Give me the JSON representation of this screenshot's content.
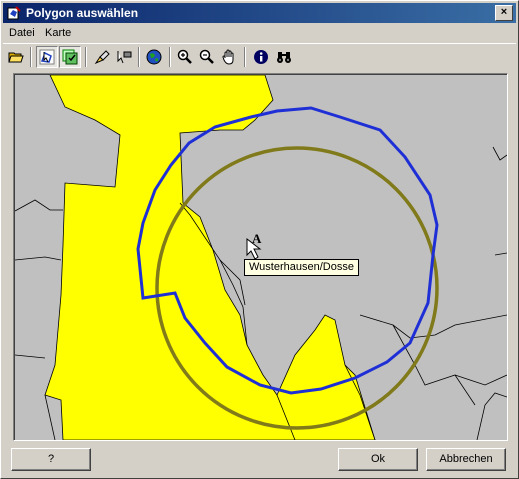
{
  "window": {
    "title": "Polygon auswählen",
    "close_glyph": "×"
  },
  "menu": [
    "Datei",
    "Karte"
  ],
  "toolbar": {
    "buttons": [
      {
        "icon": "open-folder-icon"
      },
      {
        "icon": "select-polygon-icon",
        "pressed": true
      },
      {
        "icon": "select-multiple-icon",
        "pressed": true
      },
      {
        "icon": "edit-select-icon"
      },
      {
        "icon": "arrow-flag-icon"
      },
      {
        "icon": "globe-icon"
      },
      {
        "icon": "zoom-in-icon"
      },
      {
        "icon": "zoom-out-icon"
      },
      {
        "icon": "pan-hand-icon"
      },
      {
        "icon": "info-icon"
      },
      {
        "icon": "binoculars-icon"
      }
    ]
  },
  "map": {
    "place_label": "Wusterhausen/Dosse",
    "marker_label": "A",
    "colors": {
      "background": "#c0c0c0",
      "region": "#ffff00",
      "selection": "#1f2fd6",
      "buffer": "#807a1a"
    }
  },
  "buttons": {
    "help": "?",
    "ok": "Ok",
    "cancel": "Abbrechen"
  }
}
